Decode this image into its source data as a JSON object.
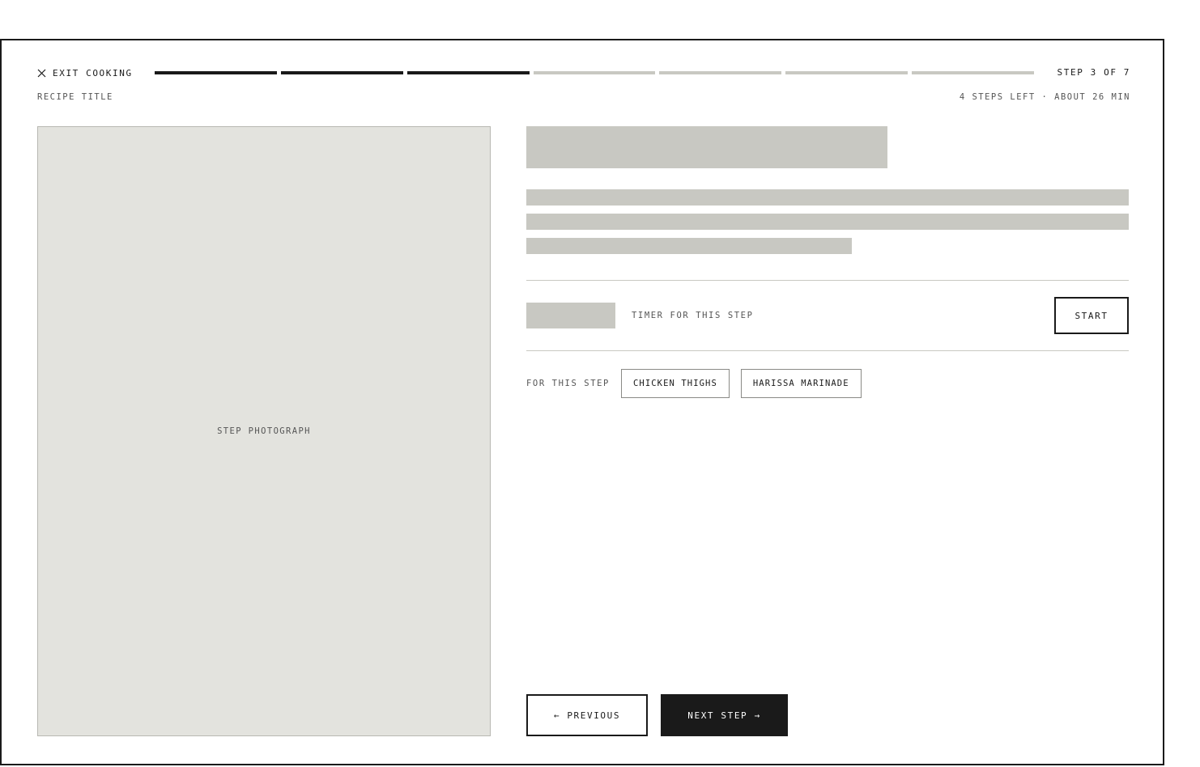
{
  "header": {
    "exit_label": "EXIT COOKING",
    "step_counter": "STEP 3 OF 7",
    "recipe_title": "RECIPE TITLE",
    "steps_meta": "4 STEPS LEFT · ABOUT 26 MIN"
  },
  "progress": {
    "total_steps": 7,
    "current_step": 3
  },
  "photo": {
    "label": "STEP PHOTOGRAPH"
  },
  "timer": {
    "label": "TIMER FOR THIS STEP",
    "start_label": "START"
  },
  "ingredients": {
    "label": "FOR THIS STEP",
    "items": [
      "CHICKEN THIGHS",
      "HARISSA MARINADE"
    ]
  },
  "nav": {
    "previous_label": "← PREVIOUS",
    "next_label": "NEXT STEP →"
  },
  "colors": {
    "ink": "#1a1a1a",
    "muted_text": "#555555",
    "placeholder": "#c8c8c2",
    "photo_bg": "#e3e3de"
  },
  "icons": {
    "exit": "close-icon"
  }
}
